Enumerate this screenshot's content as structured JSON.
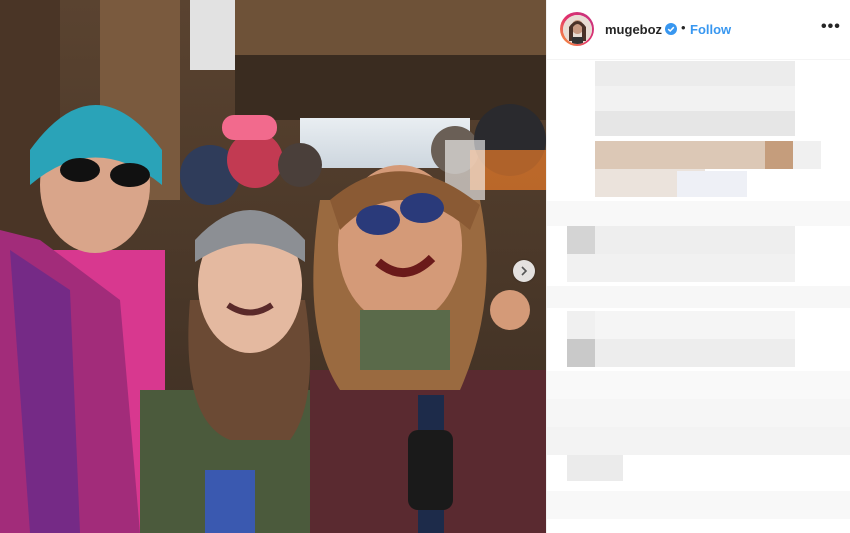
{
  "post": {
    "username": "mugeboz",
    "separator": "•",
    "follow_label": "Follow",
    "more_label": "•••",
    "verified": true
  },
  "icons": {
    "verified": "verified-badge-icon",
    "more": "more-options-icon",
    "next": "chevron-right-icon"
  },
  "colors": {
    "accent": "#3897f0",
    "text": "#262626",
    "story_ring_start": "#f9a23a",
    "story_ring_end": "#c13584"
  },
  "caption": {
    "state": "pixelated"
  }
}
